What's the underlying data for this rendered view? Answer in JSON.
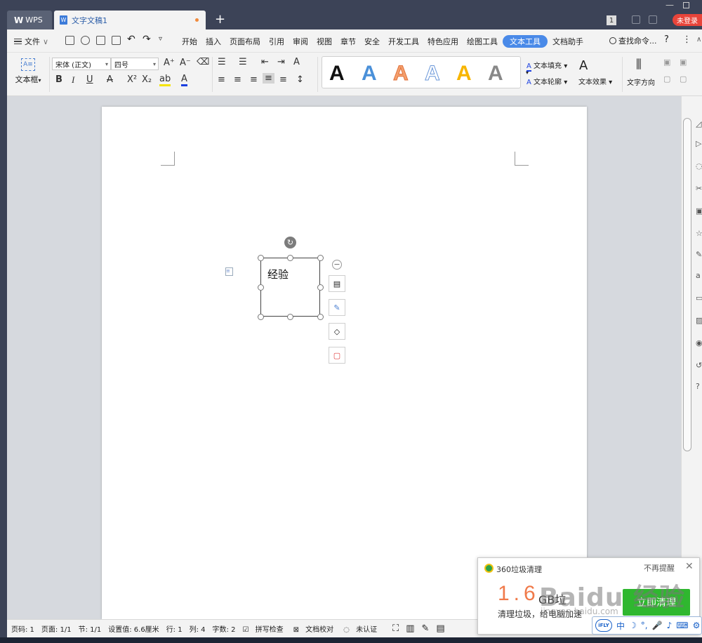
{
  "titlebar": {
    "wps_tab": "WPS",
    "doc_tab": "文字文稿1",
    "new_tab": "+",
    "login": "未登录",
    "count": "1"
  },
  "menubar": {
    "file": "文件",
    "items": [
      "开始",
      "插入",
      "页面布局",
      "引用",
      "审阅",
      "视图",
      "章节",
      "安全",
      "开发工具",
      "特色应用",
      "绘图工具"
    ],
    "active": "文本工具",
    "after": "文档助手",
    "search": "查找命令...",
    "help": "?",
    "more": "⋮"
  },
  "ribbon": {
    "textbox_label": "文本框",
    "font_name": "宋体 (正文)",
    "font_size": "四号",
    "text_fill": "文本填充",
    "text_outline": "文本轮廓",
    "text_effect": "文本效果",
    "text_direction": "文字方向",
    "style_letter": "A",
    "bold": "B",
    "italic": "I",
    "underline": "U",
    "strike": "A",
    "sup": "X²",
    "sub": "X₂",
    "grow": "A⁺",
    "shrink": "A⁻"
  },
  "document": {
    "textbox_text": "经验"
  },
  "statusbar": {
    "page_num": "页码: 1",
    "pages": "页面: 1/1",
    "section": "节: 1/1",
    "setting": "设置值: 6.6厘米",
    "row": "行: 1",
    "col": "列: 4",
    "words": "字数: 2",
    "spell": "拼写检查",
    "proof": "文档校对",
    "cert": "未认证"
  },
  "popup": {
    "title": "360垃圾清理",
    "dismiss": "不再提醒",
    "close": "✕",
    "size": "1.6",
    "unit": "GB垃",
    "subtitle": "清理垃圾，给电脑加速",
    "button": "立即清理"
  },
  "ime": {
    "logo": "iFLY",
    "lang": "中"
  },
  "watermark": {
    "main": "Baidu 经验",
    "url": "jingyan.baidu.com"
  },
  "colors": {
    "accent": "#4a8ae8",
    "popup_button": "#2fb72f",
    "login": "#e8443a"
  }
}
